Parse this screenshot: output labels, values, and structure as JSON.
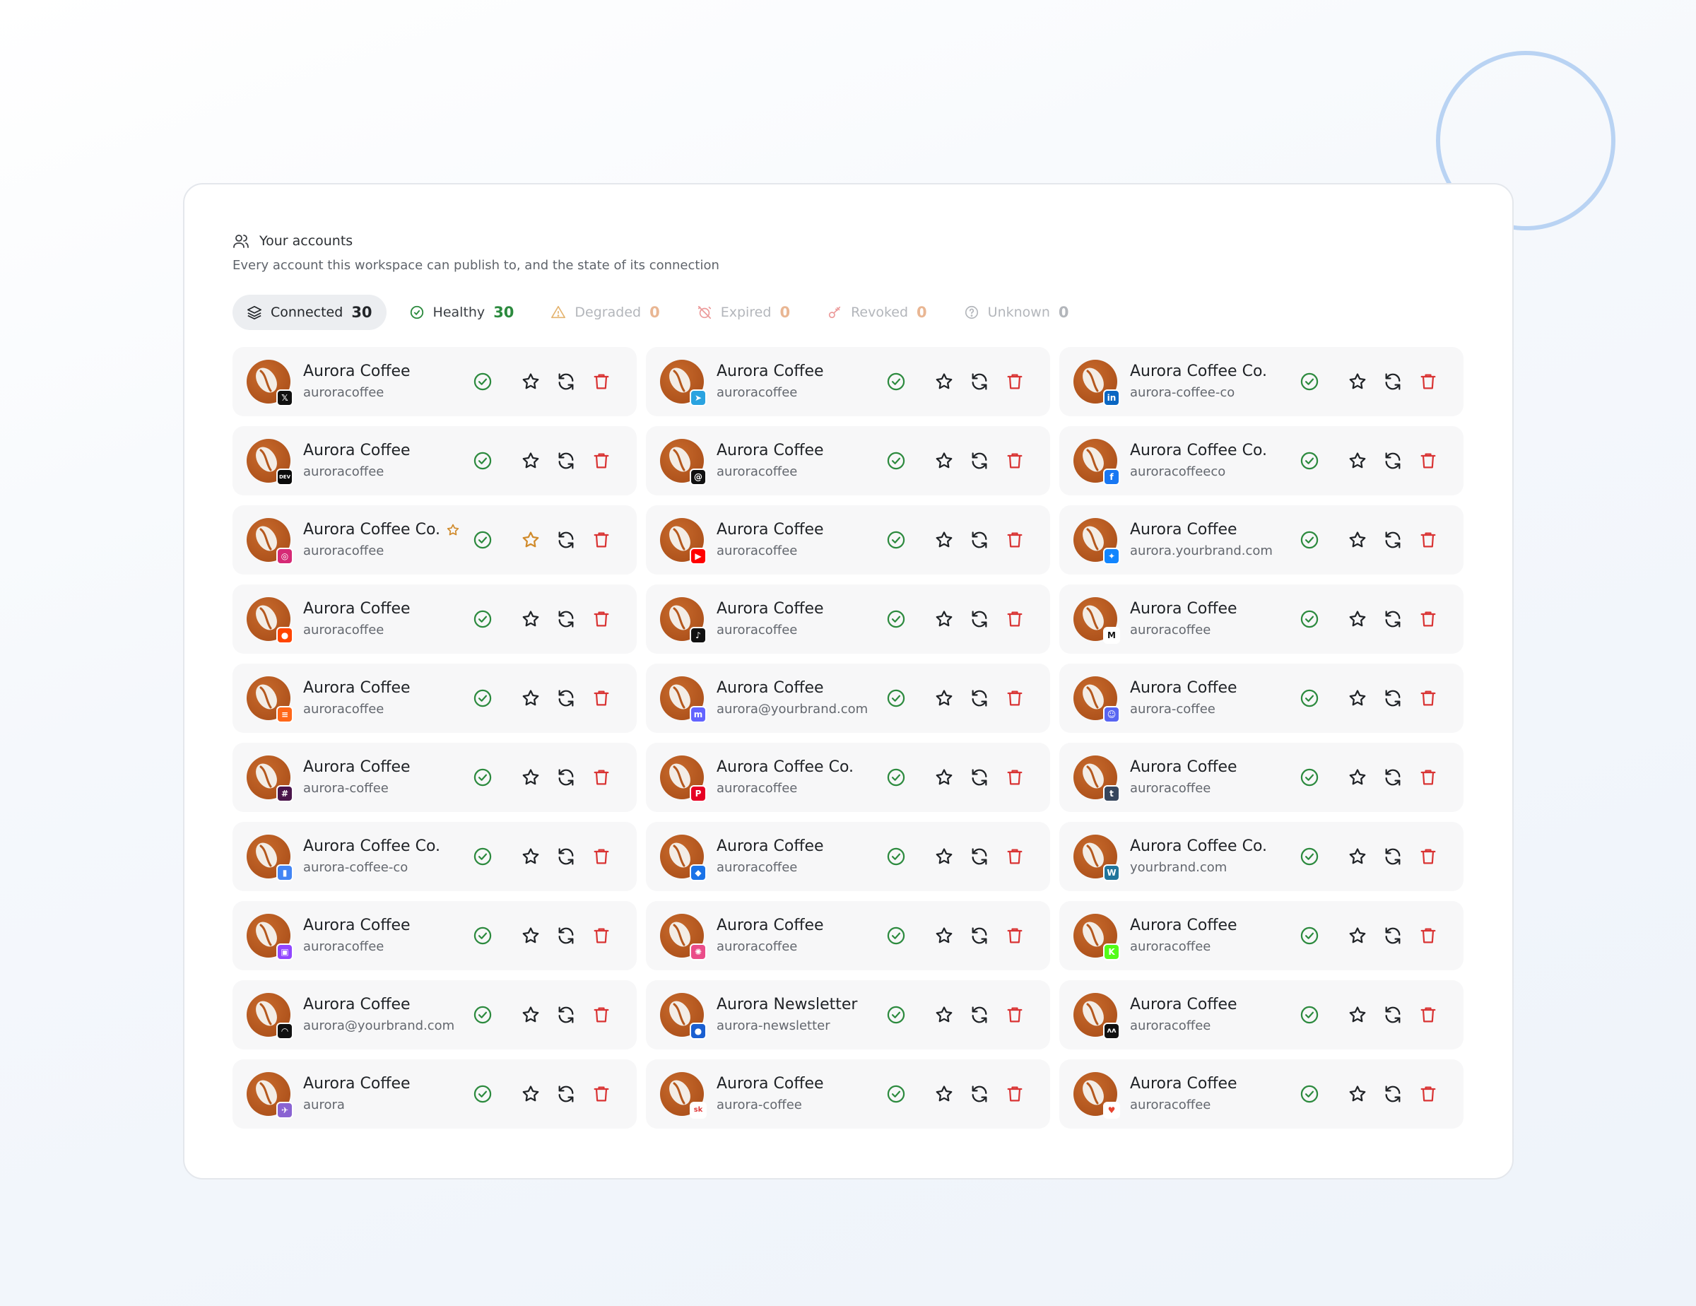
{
  "header": {
    "title": "Your accounts",
    "subtitle": "Every account this workspace can publish to, and the state of its connection"
  },
  "filters": [
    {
      "label": "Connected",
      "count": "30"
    },
    {
      "label": "Healthy",
      "count": "30"
    },
    {
      "label": "Degraded",
      "count": "0"
    },
    {
      "label": "Expired",
      "count": "0"
    },
    {
      "label": "Revoked",
      "count": "0"
    },
    {
      "label": "Unknown",
      "count": "0"
    }
  ],
  "accounts": [
    {
      "name": "Aurora Coffee",
      "handle": "auroracoffee",
      "platform": "x",
      "badge": "𝕏",
      "badge_color": "#111111",
      "favorite": false
    },
    {
      "name": "Aurora Coffee",
      "handle": "auroracoffee",
      "platform": "telegram",
      "badge": "➤",
      "badge_color": "#2aa3e0",
      "favorite": false
    },
    {
      "name": "Aurora Coffee Co.",
      "handle": "aurora-coffee-co",
      "platform": "linkedin",
      "badge": "in",
      "badge_color": "#0a66c2",
      "favorite": false
    },
    {
      "name": "Aurora Coffee",
      "handle": "auroracoffee",
      "platform": "devto",
      "badge": "DEV",
      "badge_color": "#0b0b0b",
      "favorite": false
    },
    {
      "name": "Aurora Coffee",
      "handle": "auroracoffee",
      "platform": "threads",
      "badge": "@",
      "badge_color": "#111111",
      "favorite": false
    },
    {
      "name": "Aurora Coffee Co.",
      "handle": "auroracoffeeco",
      "platform": "facebook",
      "badge": "f",
      "badge_color": "#1877f2",
      "favorite": false
    },
    {
      "name": "Aurora Coffee Co.",
      "handle": "auroracoffee",
      "platform": "instagram",
      "badge": "◎",
      "badge_color": "#d62976",
      "favorite": true
    },
    {
      "name": "Aurora Coffee",
      "handle": "auroracoffee",
      "platform": "youtube",
      "badge": "▶",
      "badge_color": "#ff0000",
      "favorite": false
    },
    {
      "name": "Aurora Coffee",
      "handle": "aurora.yourbrand.com",
      "platform": "bluesky",
      "badge": "✦",
      "badge_color": "#1185fe",
      "favorite": false
    },
    {
      "name": "Aurora Coffee",
      "handle": "auroracoffee",
      "platform": "reddit",
      "badge": "●",
      "badge_color": "#ff4500",
      "favorite": false
    },
    {
      "name": "Aurora Coffee",
      "handle": "auroracoffee",
      "platform": "tiktok",
      "badge": "♪",
      "badge_color": "#111111",
      "favorite": false
    },
    {
      "name": "Aurora Coffee",
      "handle": "auroracoffee",
      "platform": "medium",
      "badge": "M",
      "badge_color": "#ffffff",
      "favorite": false
    },
    {
      "name": "Aurora Coffee",
      "handle": "auroracoffee",
      "platform": "substack",
      "badge": "≡",
      "badge_color": "#ff6719",
      "favorite": false
    },
    {
      "name": "Aurora Coffee",
      "handle": "aurora@yourbrand.com",
      "platform": "mastodon",
      "badge": "m",
      "badge_color": "#6364ff",
      "favorite": false
    },
    {
      "name": "Aurora Coffee",
      "handle": "aurora-coffee",
      "platform": "discord",
      "badge": "☺",
      "badge_color": "#5865f2",
      "favorite": false
    },
    {
      "name": "Aurora Coffee",
      "handle": "aurora-coffee",
      "platform": "slack",
      "badge": "#",
      "badge_color": "#4a154b",
      "favorite": false
    },
    {
      "name": "Aurora Coffee Co.",
      "handle": "auroracoffee",
      "platform": "pinterest",
      "badge": "P",
      "badge_color": "#e60023",
      "favorite": false
    },
    {
      "name": "Aurora Coffee",
      "handle": "auroracoffee",
      "platform": "tumblr",
      "badge": "t",
      "badge_color": "#36465d",
      "favorite": false
    },
    {
      "name": "Aurora Coffee Co.",
      "handle": "aurora-coffee-co",
      "platform": "google-business",
      "badge": "▮",
      "badge_color": "#4285f4",
      "favorite": false
    },
    {
      "name": "Aurora Coffee",
      "handle": "auroracoffee",
      "platform": "google",
      "badge": "◆",
      "badge_color": "#1a73e8",
      "favorite": false
    },
    {
      "name": "Aurora Coffee Co.",
      "handle": "yourbrand.com",
      "platform": "wordpress",
      "badge": "W",
      "badge_color": "#21759b",
      "favorite": false
    },
    {
      "name": "Aurora Coffee",
      "handle": "auroracoffee",
      "platform": "twitch",
      "badge": "▣",
      "badge_color": "#9146ff",
      "favorite": false
    },
    {
      "name": "Aurora Coffee",
      "handle": "auroracoffee",
      "platform": "dribbble",
      "badge": "✺",
      "badge_color": "#ea4c89",
      "favorite": false
    },
    {
      "name": "Aurora Coffee",
      "handle": "auroracoffee",
      "platform": "kick",
      "badge": "K",
      "badge_color": "#53fc18",
      "favorite": false
    },
    {
      "name": "Aurora Coffee",
      "handle": "aurora@yourbrand.com",
      "platform": "lemmy",
      "badge": "◠",
      "badge_color": "#111111",
      "favorite": false
    },
    {
      "name": "Aurora Newsletter",
      "handle": "aurora-newsletter",
      "platform": "newsletter",
      "badge": "●",
      "badge_color": "#1a5fd1",
      "favorite": false
    },
    {
      "name": "Aurora Coffee",
      "handle": "auroracoffee",
      "platform": "nostr",
      "badge": "ʌʌ",
      "badge_color": "#111111",
      "favorite": false
    },
    {
      "name": "Aurora Coffee",
      "handle": "aurora",
      "platform": "warpcast",
      "badge": "✈",
      "badge_color": "#8a63d2",
      "favorite": false
    },
    {
      "name": "Aurora Coffee",
      "handle": "aurora-coffee",
      "platform": "skool",
      "badge": "sk",
      "badge_color": "#ffffff",
      "favorite": false
    },
    {
      "name": "Aurora Coffee",
      "handle": "auroracoffee",
      "platform": "vk",
      "badge": "♥",
      "badge_color": "#ffffff",
      "favorite": false
    }
  ],
  "colors": {
    "healthy": "#2c8a3e",
    "delete": "#d93434",
    "favorite": "#d08a2a",
    "avatar": "#b5581d"
  },
  "icons": {
    "header": "users-icon",
    "status": "check-circle-icon",
    "favorite": "star-icon",
    "reconnect": "refresh-icon",
    "delete": "trash-icon"
  }
}
